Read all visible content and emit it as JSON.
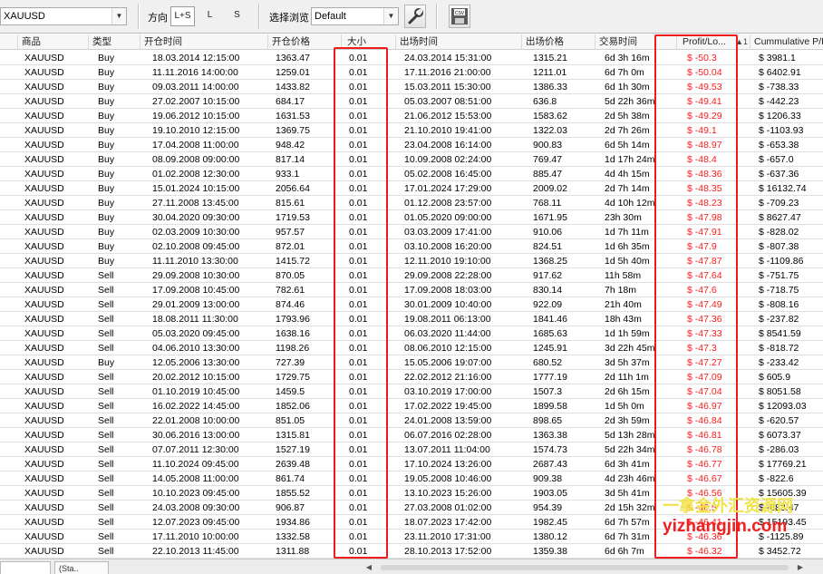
{
  "toolbar": {
    "symbol_value": "XAUUSD",
    "direction_label": "方向",
    "direction_options": [
      "L+S",
      "L",
      "S"
    ],
    "browse_label": "选择浏览",
    "browse_value": "Default"
  },
  "columns": [
    "商品",
    "类型",
    "开仓时间",
    "开仓价格",
    "大小",
    "出场时间",
    "出场价格",
    "交易时间",
    "Profit/Lo...",
    "Cummulative P/L"
  ],
  "sort_indicator": "1",
  "rows": [
    [
      "XAUUSD",
      "Buy",
      "18.03.2014 12:15:00",
      "1363.47",
      "0.01",
      "24.03.2014 15:31:00",
      "1315.21",
      "6d 3h 16m",
      "$ -50.3",
      "$ 3981.1"
    ],
    [
      "XAUUSD",
      "Buy",
      "11.11.2016 14:00:00",
      "1259.01",
      "0.01",
      "17.11.2016 21:00:00",
      "1211.01",
      "6d 7h 0m",
      "$ -50.04",
      "$ 6402.91"
    ],
    [
      "XAUUSD",
      "Buy",
      "09.03.2011 14:00:00",
      "1433.82",
      "0.01",
      "15.03.2011 15:30:00",
      "1386.33",
      "6d 1h 30m",
      "$ -49.53",
      "$ -738.33"
    ],
    [
      "XAUUSD",
      "Buy",
      "27.02.2007 10:15:00",
      "684.17",
      "0.01",
      "05.03.2007 08:51:00",
      "636.8",
      "5d 22h 36m",
      "$ -49.41",
      "$ -442.23"
    ],
    [
      "XAUUSD",
      "Buy",
      "19.06.2012 10:15:00",
      "1631.53",
      "0.01",
      "21.06.2012 15:53:00",
      "1583.62",
      "2d 5h 38m",
      "$ -49.29",
      "$ 1206.33"
    ],
    [
      "XAUUSD",
      "Buy",
      "19.10.2010 12:15:00",
      "1369.75",
      "0.01",
      "21.10.2010 19:41:00",
      "1322.03",
      "2d 7h 26m",
      "$ -49.1",
      "$ -1103.93"
    ],
    [
      "XAUUSD",
      "Buy",
      "17.04.2008 11:00:00",
      "948.42",
      "0.01",
      "23.04.2008 16:14:00",
      "900.83",
      "6d 5h 14m",
      "$ -48.97",
      "$ -653.38"
    ],
    [
      "XAUUSD",
      "Buy",
      "08.09.2008 09:00:00",
      "817.14",
      "0.01",
      "10.09.2008 02:24:00",
      "769.47",
      "1d 17h 24m",
      "$ -48.4",
      "$ -657.0"
    ],
    [
      "XAUUSD",
      "Buy",
      "01.02.2008 12:30:00",
      "933.1",
      "0.01",
      "05.02.2008 16:45:00",
      "885.47",
      "4d 4h 15m",
      "$ -48.36",
      "$ -637.36"
    ],
    [
      "XAUUSD",
      "Buy",
      "15.01.2024 10:15:00",
      "2056.64",
      "0.01",
      "17.01.2024 17:29:00",
      "2009.02",
      "2d 7h 14m",
      "$ -48.35",
      "$ 16132.74"
    ],
    [
      "XAUUSD",
      "Buy",
      "27.11.2008 13:45:00",
      "815.61",
      "0.01",
      "01.12.2008 23:57:00",
      "768.11",
      "4d 10h 12m",
      "$ -48.23",
      "$ -709.23"
    ],
    [
      "XAUUSD",
      "Buy",
      "30.04.2020 09:30:00",
      "1719.53",
      "0.01",
      "01.05.2020 09:00:00",
      "1671.95",
      "23h 30m",
      "$ -47.98",
      "$ 8627.47"
    ],
    [
      "XAUUSD",
      "Buy",
      "02.03.2009 10:30:00",
      "957.57",
      "0.01",
      "03.03.2009 17:41:00",
      "910.06",
      "1d 7h 11m",
      "$ -47.91",
      "$ -828.02"
    ],
    [
      "XAUUSD",
      "Buy",
      "02.10.2008 09:45:00",
      "872.01",
      "0.01",
      "03.10.2008 16:20:00",
      "824.51",
      "1d 6h 35m",
      "$ -47.9",
      "$ -807.38"
    ],
    [
      "XAUUSD",
      "Buy",
      "11.11.2010 13:30:00",
      "1415.72",
      "0.01",
      "12.11.2010 19:10:00",
      "1368.25",
      "1d 5h 40m",
      "$ -47.87",
      "$ -1109.86"
    ],
    [
      "XAUUSD",
      "Sell",
      "29.09.2008 10:30:00",
      "870.05",
      "0.01",
      "29.09.2008 22:28:00",
      "917.62",
      "11h 58m",
      "$ -47.64",
      "$ -751.75"
    ],
    [
      "XAUUSD",
      "Sell",
      "17.09.2008 10:45:00",
      "782.61",
      "0.01",
      "17.09.2008 18:03:00",
      "830.14",
      "7h 18m",
      "$ -47.6",
      "$ -718.75"
    ],
    [
      "XAUUSD",
      "Sell",
      "29.01.2009 13:00:00",
      "874.46",
      "0.01",
      "30.01.2009 10:40:00",
      "922.09",
      "21h 40m",
      "$ -47.49",
      "$ -808.16"
    ],
    [
      "XAUUSD",
      "Sell",
      "18.08.2011 11:30:00",
      "1793.96",
      "0.01",
      "19.08.2011 06:13:00",
      "1841.46",
      "18h 43m",
      "$ -47.36",
      "$ -237.82"
    ],
    [
      "XAUUSD",
      "Sell",
      "05.03.2020 09:45:00",
      "1638.16",
      "0.01",
      "06.03.2020 11:44:00",
      "1685.63",
      "1d 1h 59m",
      "$ -47.33",
      "$ 8541.59"
    ],
    [
      "XAUUSD",
      "Sell",
      "04.06.2010 13:30:00",
      "1198.26",
      "0.01",
      "08.06.2010 12:15:00",
      "1245.91",
      "3d 22h 45m",
      "$ -47.3",
      "$ -818.72"
    ],
    [
      "XAUUSD",
      "Buy",
      "12.05.2006 13:30:00",
      "727.39",
      "0.01",
      "15.05.2006 19:07:00",
      "680.52",
      "3d 5h 37m",
      "$ -47.27",
      "$ -233.42"
    ],
    [
      "XAUUSD",
      "Sell",
      "20.02.2012 10:15:00",
      "1729.75",
      "0.01",
      "22.02.2012 21:16:00",
      "1777.19",
      "2d 11h 1m",
      "$ -47.09",
      "$ 605.9"
    ],
    [
      "XAUUSD",
      "Sell",
      "01.10.2019 10:45:00",
      "1459.5",
      "0.01",
      "03.10.2019 17:00:00",
      "1507.3",
      "2d 6h 15m",
      "$ -47.04",
      "$ 8051.58"
    ],
    [
      "XAUUSD",
      "Sell",
      "16.02.2022 14:45:00",
      "1852.06",
      "0.01",
      "17.02.2022 19:45:00",
      "1899.58",
      "1d 5h 0m",
      "$ -46.97",
      "$ 12093.03"
    ],
    [
      "XAUUSD",
      "Sell",
      "22.01.2008 10:00:00",
      "851.05",
      "0.01",
      "24.01.2008 13:59:00",
      "898.65",
      "2d 3h 59m",
      "$ -46.84",
      "$ -620.57"
    ],
    [
      "XAUUSD",
      "Sell",
      "30.06.2016 13:00:00",
      "1315.81",
      "0.01",
      "06.07.2016 02:28:00",
      "1363.38",
      "5d 13h 28m",
      "$ -46.81",
      "$ 6073.37"
    ],
    [
      "XAUUSD",
      "Sell",
      "07.07.2011 12:30:00",
      "1527.19",
      "0.01",
      "13.07.2011 11:04:00",
      "1574.73",
      "5d 22h 34m",
      "$ -46.78",
      "$ -286.03"
    ],
    [
      "XAUUSD",
      "Sell",
      "11.10.2024 09:45:00",
      "2639.48",
      "0.01",
      "17.10.2024 13:26:00",
      "2687.43",
      "6d 3h 41m",
      "$ -46.77",
      "$ 17769.21"
    ],
    [
      "XAUUSD",
      "Sell",
      "14.05.2008 11:00:00",
      "861.74",
      "0.01",
      "19.05.2008 10:46:00",
      "909.38",
      "4d 23h 46m",
      "$ -46.67",
      "$ -822.6"
    ],
    [
      "XAUUSD",
      "Sell",
      "10.10.2023 09:45:00",
      "1855.52",
      "0.01",
      "13.10.2023 15:26:00",
      "1903.05",
      "3d 5h 41m",
      "$ -46.56",
      "$ 15605.39"
    ],
    [
      "XAUUSD",
      "Sell",
      "24.03.2008 09:30:00",
      "906.87",
      "0.01",
      "27.03.2008 01:02:00",
      "954.39",
      "2d 15h 32m",
      "$ -46.5",
      "$ -683.47"
    ],
    [
      "XAUUSD",
      "Sell",
      "12.07.2023 09:45:00",
      "1934.86",
      "0.01",
      "18.07.2023 17:42:00",
      "1982.45",
      "6d 7h 57m",
      "$ -46.41",
      "$ 15193.45"
    ],
    [
      "XAUUSD",
      "Sell",
      "17.11.2010 10:00:00",
      "1332.58",
      "0.01",
      "23.11.2010 17:31:00",
      "1380.12",
      "6d 7h 31m",
      "$ -46.36",
      "$ -1125.89"
    ],
    [
      "XAUUSD",
      "Sell",
      "22.10.2013 11:45:00",
      "1311.88",
      "0.01",
      "28.10.2013 17:52:00",
      "1359.38",
      "6d 6h 7m",
      "$ -46.32",
      "$ 3452.72"
    ]
  ],
  "watermark": {
    "line1": "一拿金外汇资源网",
    "line2": "yizhangjin.com"
  },
  "colors": {
    "loss": "#ff1a1a",
    "highlight_box": "#ef1c1c"
  },
  "bottom_tabs": [
    "",
    "(Sta.."
  ]
}
